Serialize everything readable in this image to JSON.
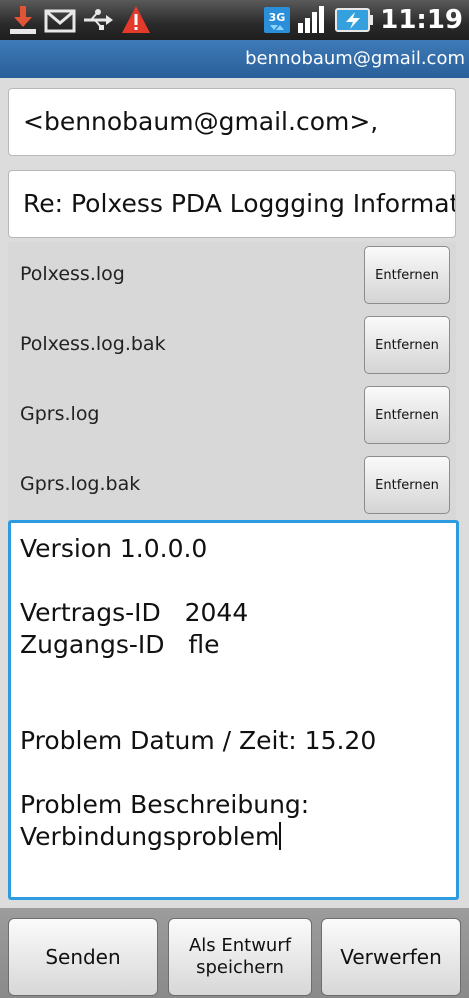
{
  "status_bar": {
    "time": "11:19",
    "notification_icons": [
      "usb-download-icon",
      "gmail-icon",
      "usb-debug-icon",
      "warning-icon"
    ],
    "network_label": "3G",
    "icons_right": [
      "3g-icon",
      "signal-icon",
      "battery-charging-icon"
    ]
  },
  "account": {
    "email": "bennobaum@gmail.com"
  },
  "to_field": {
    "value": "<bennobaum@gmail.com>,"
  },
  "subject_field": {
    "value": "Re: Polxess PDA Loggging Informati"
  },
  "attachments": [
    {
      "name": "Polxess.log",
      "remove_label": "Entfernen"
    },
    {
      "name": "Polxess.log.bak",
      "remove_label": "Entfernen"
    },
    {
      "name": "Gprs.log",
      "remove_label": "Entfernen"
    },
    {
      "name": "Gprs.log.bak",
      "remove_label": "Entfernen"
    }
  ],
  "body": {
    "lines": [
      "Version 1.0.0.0",
      "",
      "Vertrags-ID   2044",
      "Zugangs-ID   fle",
      "",
      "",
      "Problem Datum / Zeit: 15.20",
      "",
      "Problem Beschreibung:",
      "Verbindungsproblem"
    ]
  },
  "buttons": {
    "send": "Senden",
    "draft_line1": "Als Entwurf",
    "draft_line2": "speichern",
    "discard": "Verwerfen"
  },
  "colors": {
    "account_bar": "#3a74b0",
    "focus_border": "#2d9be0",
    "warning": "#e33a2c",
    "battery": "#34a0dd"
  }
}
